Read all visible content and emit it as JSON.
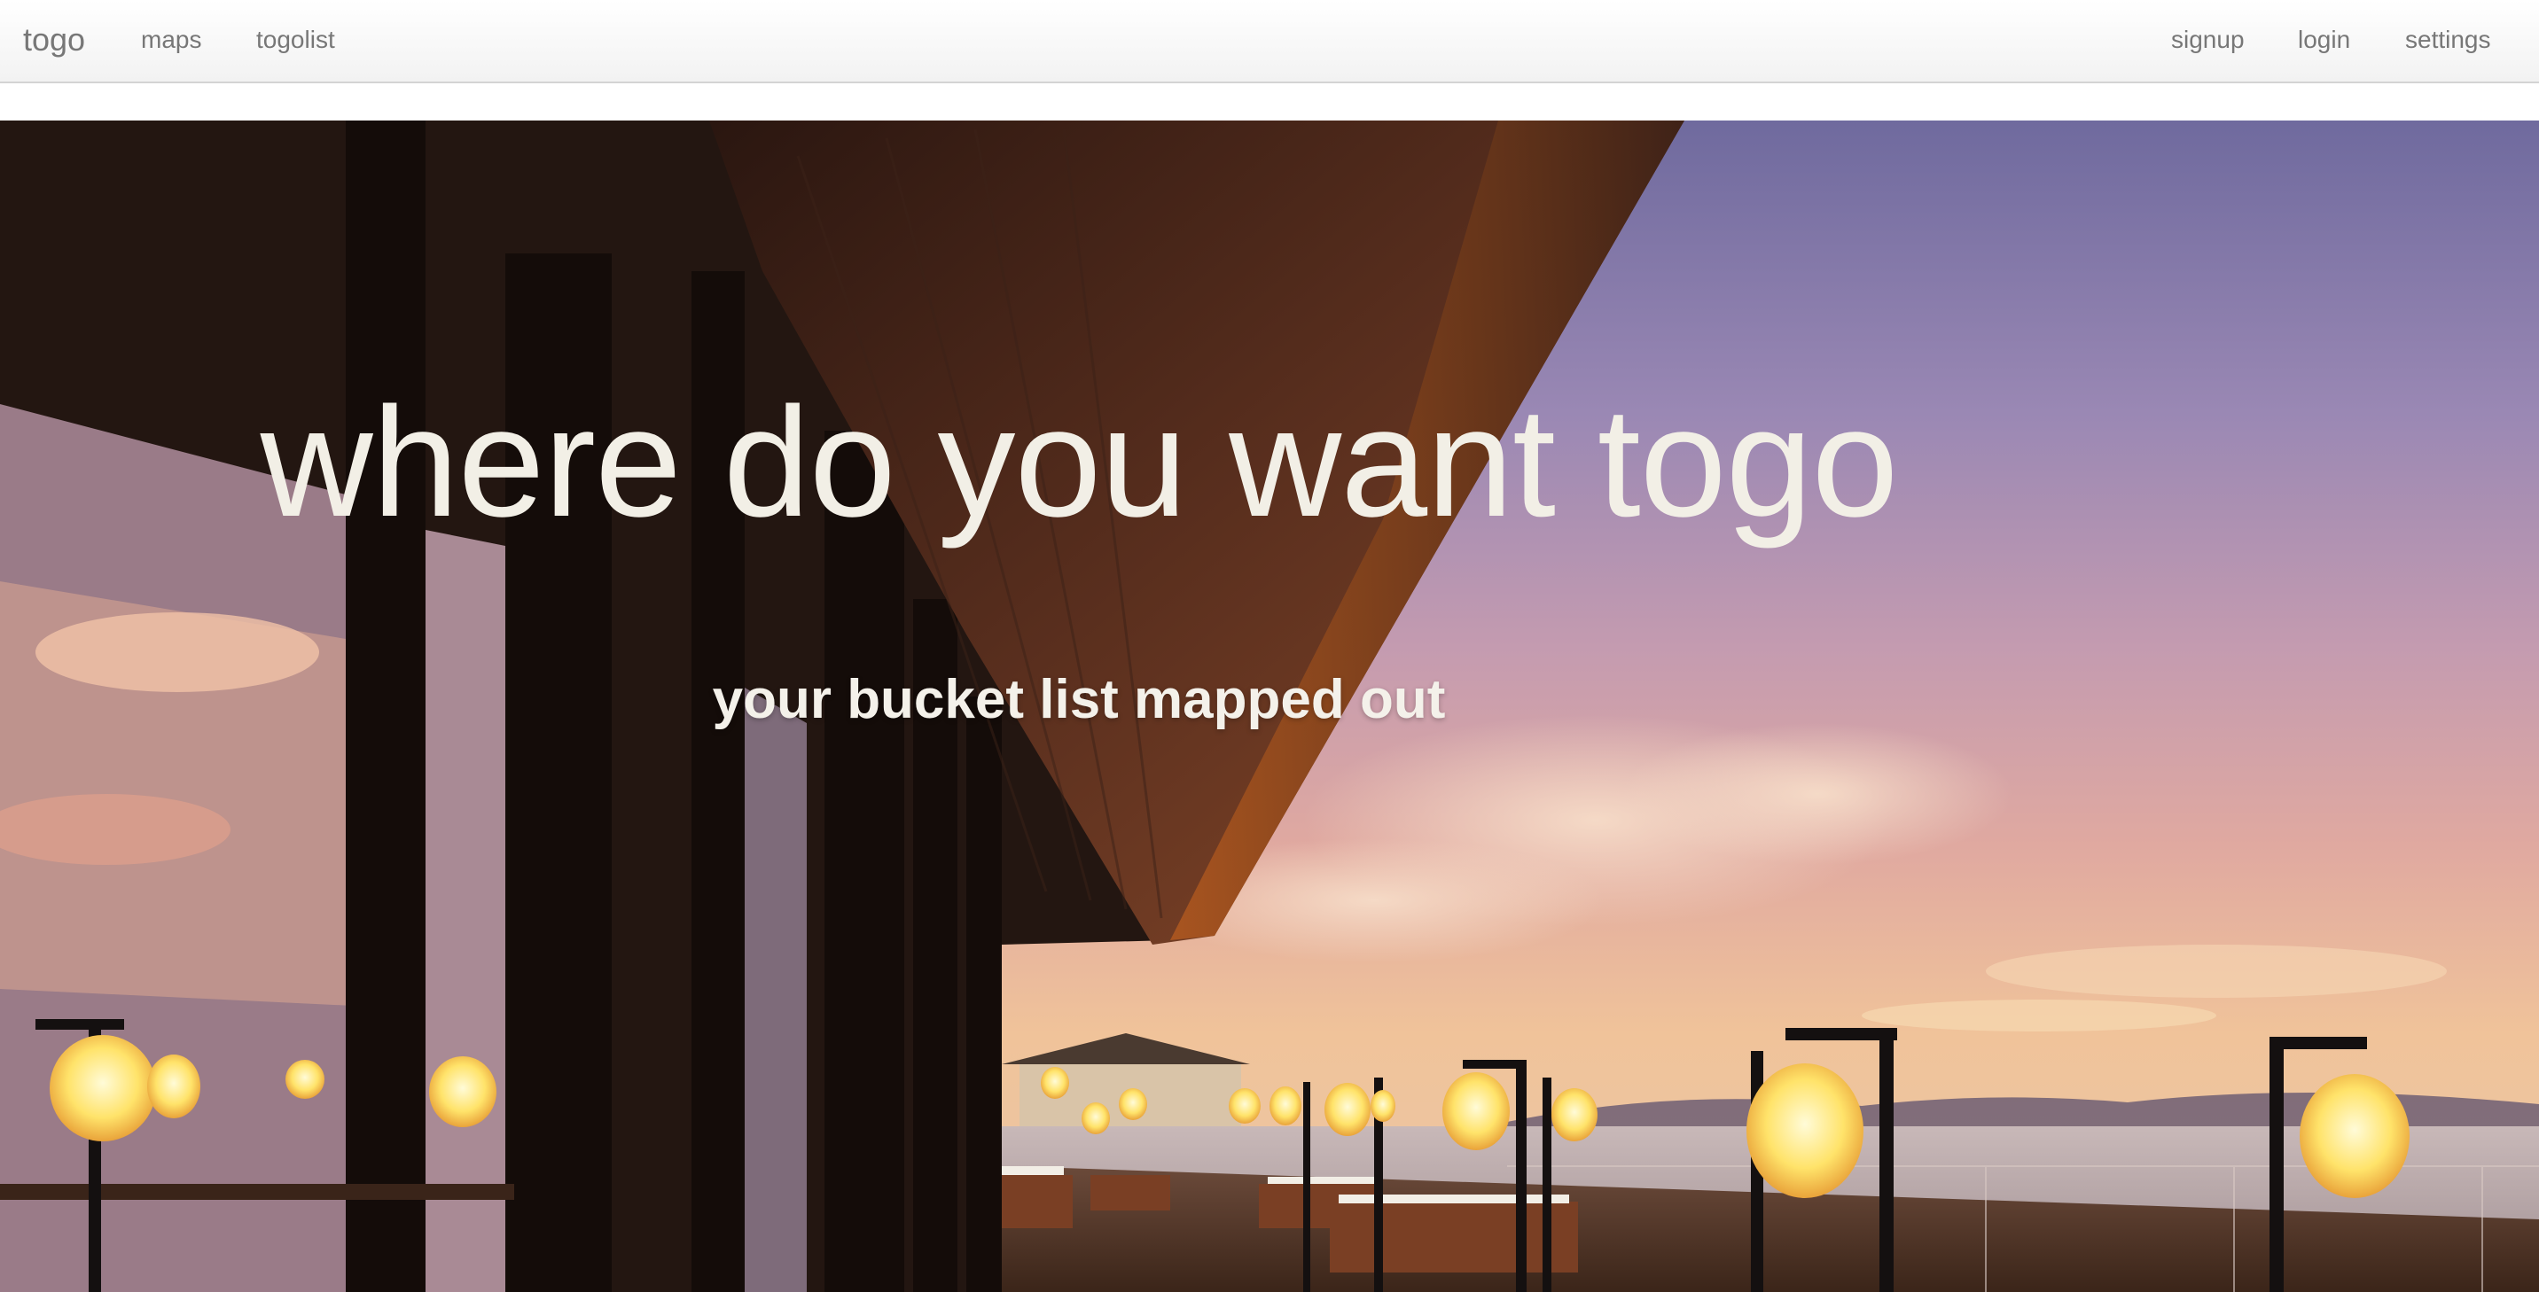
{
  "navbar": {
    "brand": "togo",
    "left_links": [
      "maps",
      "togolist"
    ],
    "right_links": [
      "signup",
      "login",
      "settings"
    ]
  },
  "hero": {
    "title": "where do you want togo",
    "subtitle": "your bucket list mapped out",
    "image": "restaurant-terrace-sunset-photo"
  },
  "colors": {
    "nav_text": "#777777",
    "hero_text": "#f2efe6"
  }
}
